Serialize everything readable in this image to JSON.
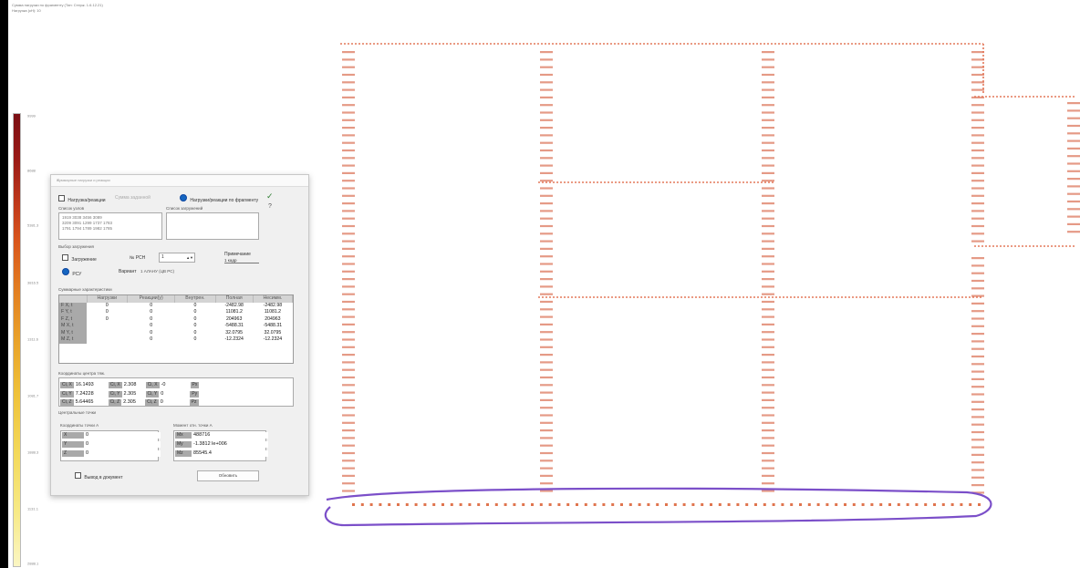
{
  "header": {
    "line1": "Сумма нагрузки по фрагменту  (Тип: Стерж. 1.6.12.21)",
    "line2": "Нагрузка (кН):  10"
  },
  "legend": {
    "ticks": [
      "9999",
      "8688",
      "5381.3",
      "3816.5",
      "1311.6",
      "1081.7",
      "1888.3",
      "1131.1",
      "2888.1"
    ]
  },
  "dialog": {
    "title": "Суммарные нагрузки и реакции",
    "mode_options": [
      "Нагрузка/реакции",
      "Сумма заданной",
      "Нагрузки/реакции по фрагменту"
    ],
    "elements_list_label": "Список узлов",
    "elements_list_text": [
      "1919 3038 3456 3089",
      "3209 3091 1299 1737 1783",
      "1791 1794 1789 1982 1785"
    ],
    "load_list_label": "Список загружений",
    "load_select_label": "Выбор загружения",
    "load_option_1": "Загружение",
    "load_option_2": "РСУ",
    "load_number_label": "№ РСН",
    "load_number_value": "1",
    "variant_label": "Вариант",
    "variant_value": "1 АЛАНУ (ЦВ РС)",
    "interval_label": "Примечание",
    "interval_value": "1 кадр",
    "sum_group_label": "Суммарные характеристики",
    "table_headers": [
      "",
      "Нагрузки",
      "Реакции(у)",
      "Внутрен.",
      "Полная",
      "Несимм."
    ],
    "table_rows": [
      {
        "label": "F X, t",
        "c1": "0",
        "c2": "0",
        "c3": "0",
        "c4": "-2482.98",
        "c5": "-2482.98"
      },
      {
        "label": "F Y, t",
        "c1": "0",
        "c2": "0",
        "c3": "0",
        "c4": "11081.2",
        "c5": "11081.2"
      },
      {
        "label": "F Z, t",
        "c1": "0",
        "c2": "0",
        "c3": "0",
        "c4": "204963",
        "c5": "204963"
      },
      {
        "label": "M X, t",
        "c1": "",
        "c2": "0",
        "c3": "0",
        "c4": "-5488.31",
        "c5": "-5488.31"
      },
      {
        "label": "M Y, t",
        "c1": "",
        "c2": "0",
        "c3": "0",
        "c4": "32.0795",
        "c5": "32.0795"
      },
      {
        "label": "M Z, t",
        "c1": "",
        "c2": "0",
        "c3": "0",
        "c4": "-12.2324",
        "c5": "-12.2324"
      }
    ],
    "result_group_label": "Координаты центра тяж.",
    "results": [
      {
        "l1": "Ci, X",
        "v1": "16.1493",
        "l2": "Ci, X",
        "v2": "2.308",
        "l3": "Ci, X",
        "v3": "-0",
        "l4": "Px",
        "v4": ""
      },
      {
        "l1": "Ci, Y",
        "v1": "7.24228",
        "l2": "Ci, Y",
        "v2": "2.305",
        "l3": "Ci, Y",
        "v3": "0",
        "l4": "Py",
        "v4": ""
      },
      {
        "l1": "Ci, Z",
        "v1": "5.64465",
        "l2": "Ci, Z",
        "v2": "2.305",
        "l3": "Ci, Z",
        "v3": "0",
        "l4": "Pz",
        "v4": ""
      }
    ],
    "center_group_label": "Центральные точки",
    "point_group_label": "Координаты точки А",
    "point_rows": [
      {
        "label": "X",
        "value": "0"
      },
      {
        "label": "Y",
        "value": "0"
      },
      {
        "label": "Z",
        "value": "0"
      }
    ],
    "moment_group_label": "Момент отн. точки А",
    "moment_rows": [
      {
        "label": "Mx",
        "value": "488716"
      },
      {
        "label": "My",
        "value": "-1.3812 le+006"
      },
      {
        "label": "Mz",
        "value": "85545.4"
      }
    ],
    "checkbox_label": "Вывод в документ",
    "update_button": "Обновить"
  }
}
